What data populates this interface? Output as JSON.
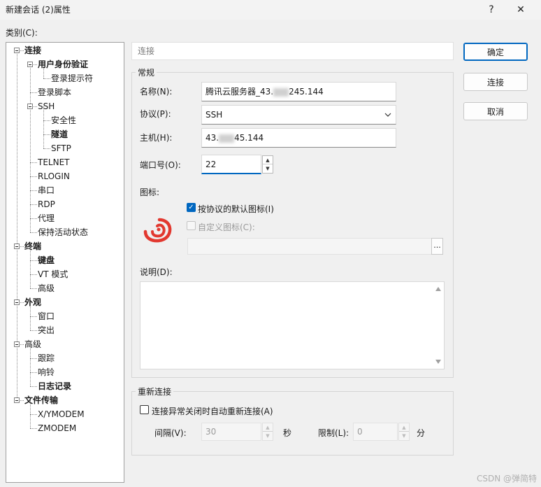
{
  "window": {
    "title": "新建会话 (2)属性",
    "help_label": "?",
    "close_label": "✕"
  },
  "category_label": "类别(C):",
  "tree": [
    {
      "label": "连接",
      "bold": true
    },
    {
      "label": "用户身份验证",
      "bold": true
    },
    {
      "label": "登录提示符",
      "bold": false
    },
    {
      "label": "登录脚本",
      "bold": false
    },
    {
      "label": "SSH",
      "bold": false
    },
    {
      "label": "安全性",
      "bold": false
    },
    {
      "label": "隧道",
      "bold": true
    },
    {
      "label": "SFTP",
      "bold": false
    },
    {
      "label": "TELNET",
      "bold": false
    },
    {
      "label": "RLOGIN",
      "bold": false
    },
    {
      "label": "串口",
      "bold": false
    },
    {
      "label": "RDP",
      "bold": false
    },
    {
      "label": "代理",
      "bold": false
    },
    {
      "label": "保持活动状态",
      "bold": false
    },
    {
      "label": "终端",
      "bold": true
    },
    {
      "label": "键盘",
      "bold": true
    },
    {
      "label": "VT 模式",
      "bold": false
    },
    {
      "label": "高级",
      "bold": false
    },
    {
      "label": "外观",
      "bold": true
    },
    {
      "label": "窗口",
      "bold": false
    },
    {
      "label": "突出",
      "bold": false
    },
    {
      "label": "高级",
      "bold": false
    },
    {
      "label": "跟踪",
      "bold": false
    },
    {
      "label": "响铃",
      "bold": false
    },
    {
      "label": "日志记录",
      "bold": true
    },
    {
      "label": "文件传输",
      "bold": true
    },
    {
      "label": "X/YMODEM",
      "bold": false
    },
    {
      "label": "ZMODEM",
      "bold": false
    }
  ],
  "section_header": "连接",
  "buttons": {
    "ok": "确定",
    "connect": "连接",
    "cancel": "取消"
  },
  "general": {
    "group_label": "常规",
    "name_label": "名称(N):",
    "name_value_prefix": "腾讯云服务器_43.",
    "name_value_suffix": "245.144",
    "protocol_label": "协议(P):",
    "protocol_value": "SSH",
    "host_label": "主机(H):",
    "host_value_prefix": "43.",
    "host_value_suffix": "45.144",
    "port_label": "端口号(O):",
    "port_value": "22",
    "icon_label": "图标:",
    "default_icon_label": "按协议的默认图标(I)",
    "custom_icon_label": "自定义图标(C):",
    "browse_label": "...",
    "desc_label": "说明(D):"
  },
  "reconnect": {
    "group_label": "重新连接",
    "auto_label": "连接异常关闭时自动重新连接(A)",
    "interval_label": "间隔(V):",
    "interval_value": "30",
    "interval_unit": "秒",
    "limit_label": "限制(L):",
    "limit_value": "0",
    "limit_unit": "分"
  },
  "watermark": "CSDN @弹简特"
}
